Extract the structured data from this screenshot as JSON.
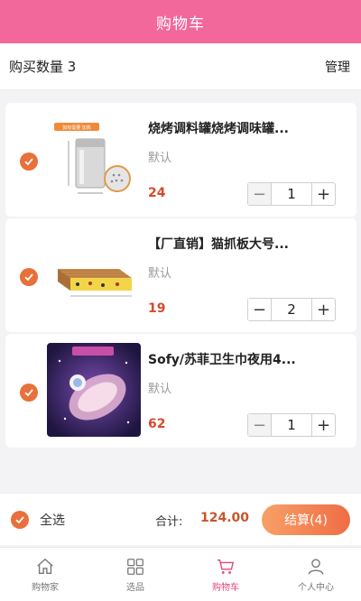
{
  "header": {
    "title": "购物车"
  },
  "subheader": {
    "count_text": "购买数量 3",
    "manage_label": "管理"
  },
  "items": [
    {
      "name": "烧烤调料罐烧烤调味罐...",
      "spec": "默认",
      "price": "24",
      "qty": "1",
      "thumb_tag": "如有需要 加高",
      "minus": "−",
      "plus": "+"
    },
    {
      "name": "【厂直销】猫抓板大号...",
      "spec": "默认",
      "price": "19",
      "qty": "2",
      "minus": "−",
      "plus": "+"
    },
    {
      "name": "Sofy/苏菲卫生巾夜用4...",
      "spec": "默认",
      "price": "62",
      "qty": "1",
      "minus": "−",
      "plus": "+"
    }
  ],
  "checkout": {
    "select_all_label": "全选",
    "total_label": "合计:",
    "total_value": "124.00",
    "pay_label": "结算(4)"
  },
  "tabs": [
    {
      "label": "购物家",
      "icon": "home-icon"
    },
    {
      "label": "选品",
      "icon": "grid-icon"
    },
    {
      "label": "购物车",
      "icon": "cart-icon",
      "active": true
    },
    {
      "label": "个人中心",
      "icon": "user-icon"
    }
  ],
  "colors": {
    "header": "#f2689a",
    "accent": "#e8703a",
    "price": "#d9482b",
    "active_tab": "#e0487a"
  }
}
